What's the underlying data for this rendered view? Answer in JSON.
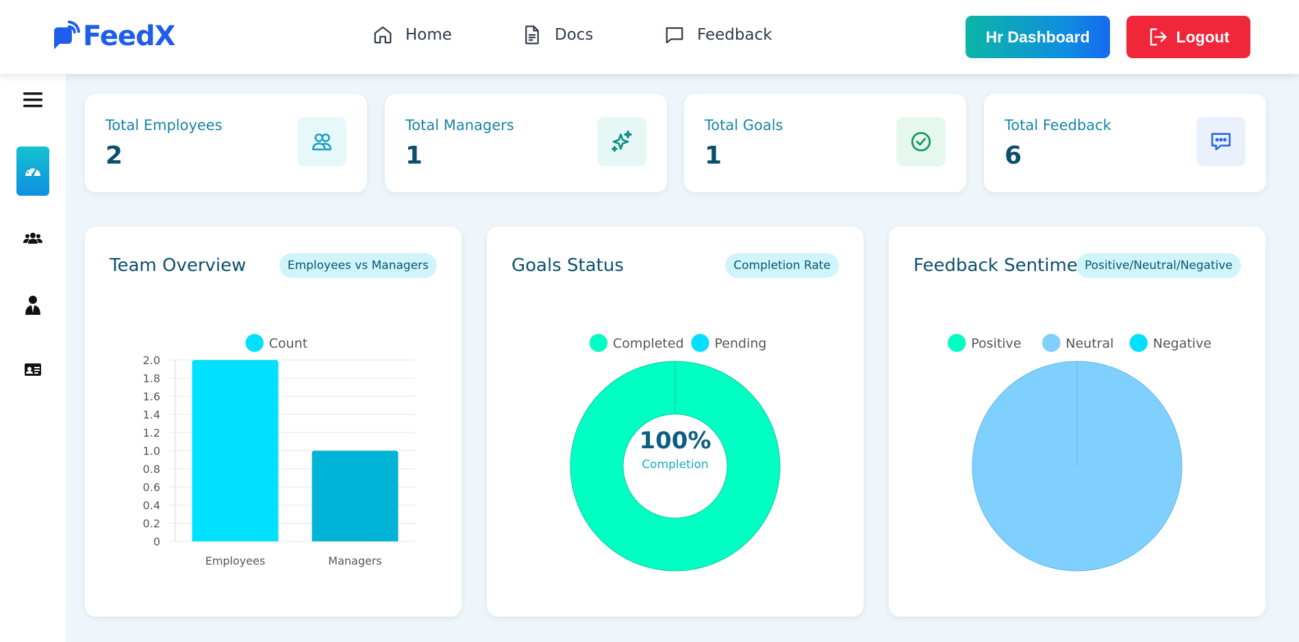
{
  "header": {
    "logo_text": "FeedX",
    "nav": [
      {
        "label": "Home",
        "icon": "home-icon"
      },
      {
        "label": "Docs",
        "icon": "document-icon"
      },
      {
        "label": "Feedback",
        "icon": "message-icon"
      }
    ],
    "hr_button": "Hr Dashboard",
    "logout_button": "Logout"
  },
  "sidebar": {
    "items": [
      {
        "icon": "menu-icon"
      },
      {
        "icon": "dashboard-gauge-icon",
        "active": true
      },
      {
        "icon": "users-group-icon"
      },
      {
        "icon": "manager-icon"
      },
      {
        "icon": "id-card-icon"
      }
    ]
  },
  "stats": [
    {
      "label": "Total Employees",
      "value": "2",
      "icon": "users-icon",
      "icon_color": "#1a9fc0",
      "icon_bg": "#e7f8fb"
    },
    {
      "label": "Total Managers",
      "value": "1",
      "icon": "sparkles-icon",
      "icon_color": "#0f8f86",
      "icon_bg": "#e6f7f5"
    },
    {
      "label": "Total Goals",
      "value": "1",
      "icon": "check-circle-icon",
      "icon_color": "#149a5c",
      "icon_bg": "#e6f7ee"
    },
    {
      "label": "Total Feedback",
      "value": "6",
      "icon": "chat-icon",
      "icon_color": "#2563eb",
      "icon_bg": "#eaf1fd"
    }
  ],
  "cards": {
    "team": {
      "title": "Team Overview",
      "pill": "Employees vs Managers"
    },
    "goals": {
      "title": "Goals Status",
      "pill": "Completion Rate",
      "center_value": "100%",
      "center_label": "Completion"
    },
    "sentiment": {
      "title": "Feedback Sentiment",
      "pill": "Positive/Neutral/Negative"
    }
  },
  "colors": {
    "bar_employees": "#00e0ff",
    "bar_managers": "#00b4d8",
    "completed": "#00ffc3",
    "pending": "#00e0ff",
    "positive": "#00ffc3",
    "neutral": "#80d0ff",
    "negative": "#00e0ff"
  },
  "chart_data": [
    {
      "type": "bar",
      "categories": [
        "Employees",
        "Managers"
      ],
      "series": [
        {
          "name": "Count",
          "values": [
            2,
            1
          ]
        }
      ],
      "ylim": [
        0,
        2.0
      ],
      "yticks": [
        "0",
        "0.2",
        "0.4",
        "0.6",
        "0.8",
        "1.0",
        "1.2",
        "1.4",
        "1.6",
        "1.8",
        "2.0"
      ],
      "legend": "top",
      "grid": true
    },
    {
      "type": "pie",
      "subtype": "doughnut",
      "labels": [
        "Completed",
        "Pending"
      ],
      "values": [
        1,
        0
      ],
      "legend": "top"
    },
    {
      "type": "pie",
      "labels": [
        "Positive",
        "Neutral",
        "Negative"
      ],
      "values": [
        0,
        6,
        0
      ],
      "legend": "top"
    }
  ]
}
